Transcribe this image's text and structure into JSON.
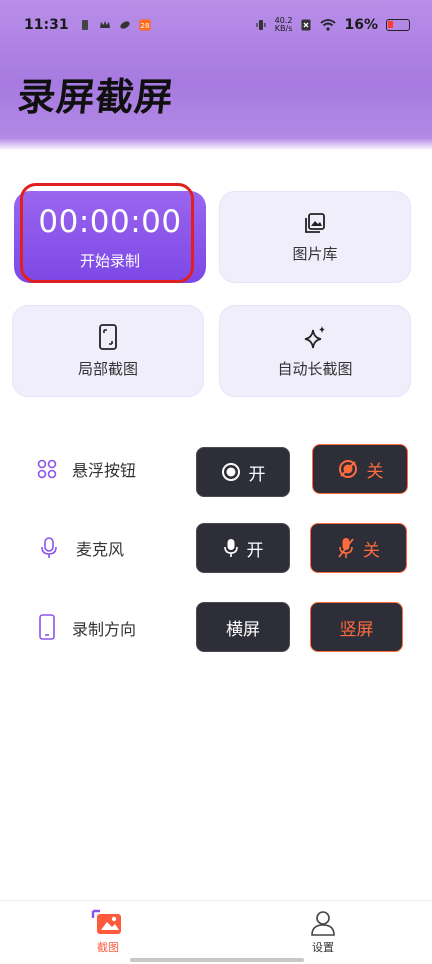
{
  "status_bar": {
    "time": "11:31",
    "speed_value": "40.2",
    "speed_unit": "KB/s",
    "battery_text": "16%"
  },
  "app_title": "录屏截屏",
  "cards": {
    "record": {
      "timer": "00:00:00",
      "label": "开始录制"
    },
    "gallery": {
      "label": "图片库",
      "icon": "gallery-icon"
    },
    "partial": {
      "label": "局部截图",
      "icon": "phone-crop-icon"
    },
    "long": {
      "label": "自动长截图",
      "icon": "sparkle-icon"
    }
  },
  "settings": {
    "floating_button": {
      "label": "悬浮按钮",
      "on_label": "开",
      "off_label": "关"
    },
    "microphone": {
      "label": "麦克风",
      "on_label": "开",
      "off_label": "关"
    },
    "orientation": {
      "label": "录制方向",
      "landscape_label": "横屏",
      "portrait_label": "竖屏"
    }
  },
  "bottom_nav": {
    "screenshot": {
      "label": "截图",
      "active": true
    },
    "settings": {
      "label": "设置",
      "active": false
    }
  },
  "colors": {
    "accent_purple": "#8a55ea",
    "header_purple": "#b08ae6",
    "dark_button": "#2d2e38",
    "off_orange": "#ff6b3d",
    "highlight_red": "#e02020",
    "nav_active": "#ff5a3c"
  }
}
